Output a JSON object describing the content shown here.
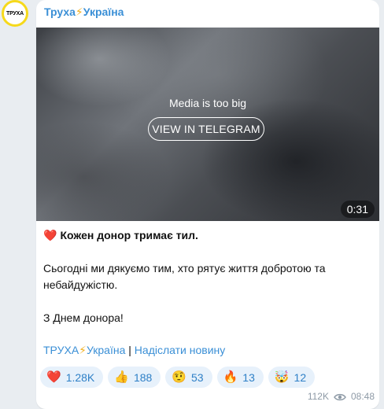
{
  "channel": {
    "avatar_text": "ТРУХА",
    "name_part1": "Труха",
    "bolt": "⚡",
    "name_part2": "Україна"
  },
  "media": {
    "message": "Media is too big",
    "button_label": "VIEW IN TELEGRAM",
    "duration": "0:31"
  },
  "post": {
    "heading_emoji": "❤️",
    "heading": "Кожен донор тримає тил.",
    "paragraph": "Сьогодні ми дякуємо тим, хто рятує життя добротою та небайдужістю.",
    "closing": "З Днем донора!"
  },
  "links": {
    "channel_link_part1": "ТРУХА",
    "channel_link_bolt": "⚡",
    "channel_link_part2": "Україна",
    "separator": " | ",
    "submit_link": "Надіслати новину"
  },
  "reactions": [
    {
      "emoji": "❤️",
      "count": "1.28K"
    },
    {
      "emoji": "👍",
      "count": "188"
    },
    {
      "emoji": "🤨",
      "count": "53"
    },
    {
      "emoji": "🔥",
      "count": "13"
    },
    {
      "emoji": "🤯",
      "count": "12"
    }
  ],
  "meta": {
    "views": "112K",
    "time": "08:48"
  },
  "colors": {
    "accent": "#3a8fd6",
    "avatar_ring": "#f6d91b",
    "reaction_bg": "#e7f1fb"
  }
}
